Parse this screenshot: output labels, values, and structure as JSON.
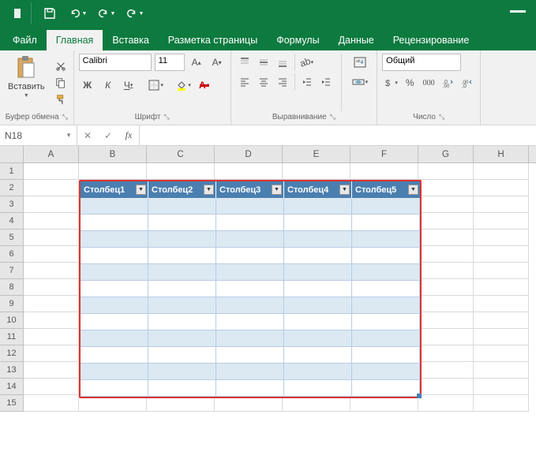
{
  "tabs": {
    "file": "Файл",
    "home": "Главная",
    "insert": "Вставка",
    "pagelayout": "Разметка страницы",
    "formulas": "Формулы",
    "data": "Данные",
    "review": "Рецензирование"
  },
  "ribbon": {
    "paste": "Вставить",
    "clipboard_group": "Буфер обмена",
    "font_name": "Calibri",
    "font_size": "11",
    "font_group": "Шрифт",
    "align_group": "Выравнивание",
    "number_format": "Общий",
    "number_group": "Число",
    "bold": "Ж",
    "italic": "К",
    "underline": "Ч"
  },
  "namebox": "N18",
  "columns": [
    "A",
    "B",
    "C",
    "D",
    "E",
    "F",
    "G",
    "H"
  ],
  "rows": [
    "1",
    "2",
    "3",
    "4",
    "5",
    "6",
    "7",
    "8",
    "9",
    "10",
    "11",
    "12",
    "13",
    "14",
    "15"
  ],
  "table_headers": [
    "Столбец1",
    "Столбец2",
    "Столбец3",
    "Столбец4",
    "Столбец5"
  ],
  "table_body_rows": 12
}
